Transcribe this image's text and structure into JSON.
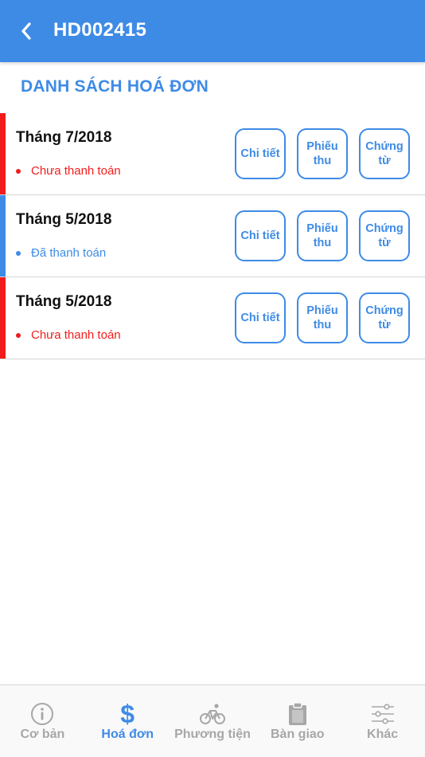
{
  "header": {
    "title": "HD002415"
  },
  "section": {
    "title": "DANH SÁCH HOÁ ĐƠN"
  },
  "colors": {
    "primary": "#3e8be6",
    "unpaid": "#f21c1c",
    "paid": "#3e8be6",
    "inactive": "#a7a7a7"
  },
  "invoices": [
    {
      "month": "Tháng 7/2018",
      "status": "Chưa thanh toán",
      "status_type": "unpaid",
      "buttons": {
        "detail": "Chi tiết",
        "receipt": "Phiếu thu",
        "voucher": "Chứng từ"
      }
    },
    {
      "month": "Tháng 5/2018",
      "status": "Đã thanh toán",
      "status_type": "paid",
      "buttons": {
        "detail": "Chi tiết",
        "receipt": "Phiếu thu",
        "voucher": "Chứng từ"
      }
    },
    {
      "month": "Tháng 5/2018",
      "status": "Chưa thanh toán",
      "status_type": "unpaid",
      "buttons": {
        "detail": "Chi tiết",
        "receipt": "Phiếu thu",
        "voucher": "Chứng từ"
      }
    }
  ],
  "tabs": [
    {
      "label": "Cơ bản",
      "icon": "info-icon",
      "active": false
    },
    {
      "label": "Hoá đơn",
      "icon": "dollar-icon",
      "active": true
    },
    {
      "label": "Phương tiện",
      "icon": "bicycle-icon",
      "active": false
    },
    {
      "label": "Bàn giao",
      "icon": "clipboard-icon",
      "active": false
    },
    {
      "label": "Khác",
      "icon": "sliders-icon",
      "active": false
    }
  ]
}
